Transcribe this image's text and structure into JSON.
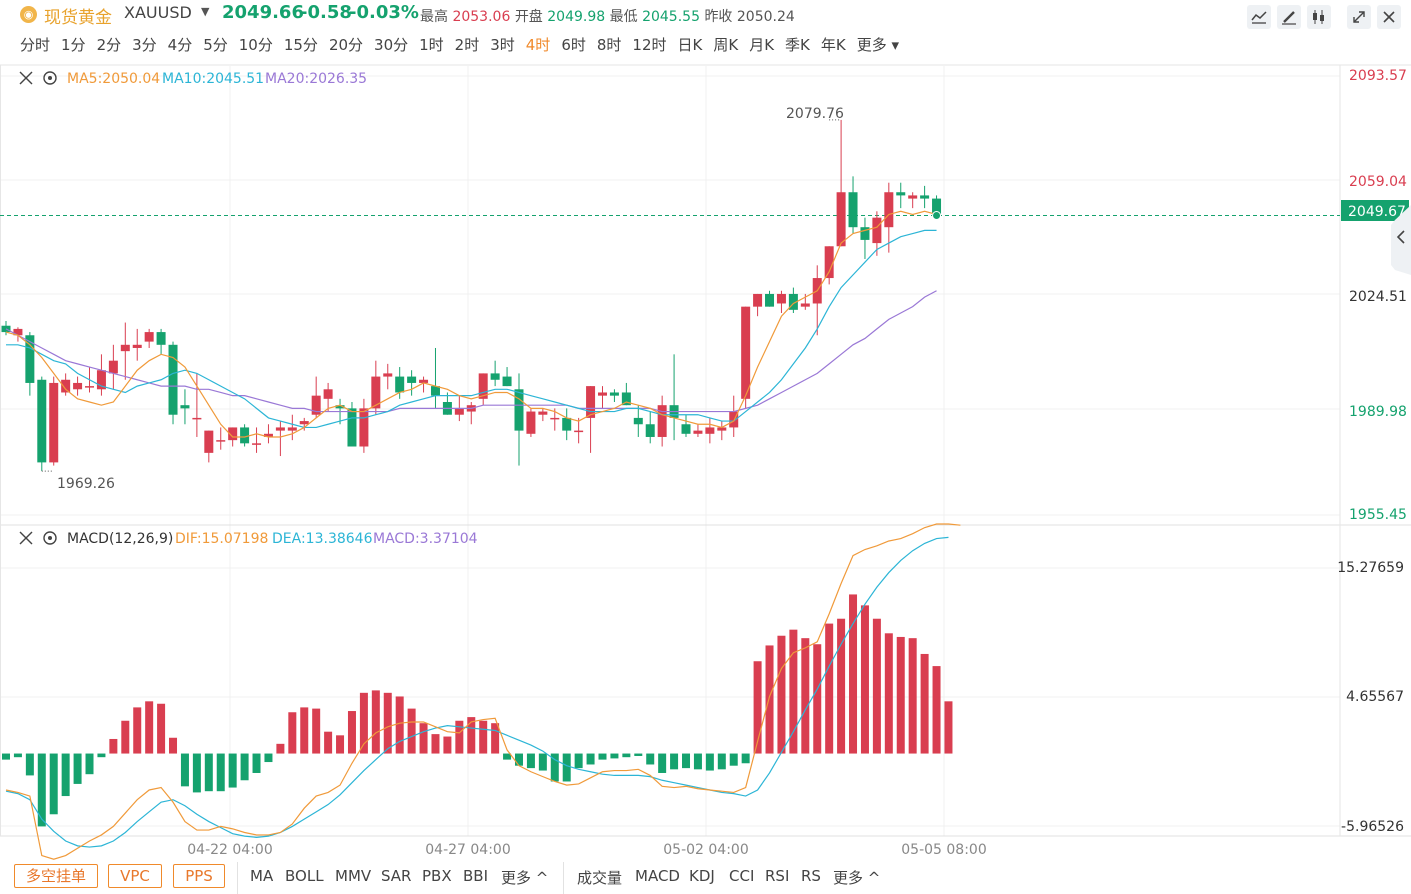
{
  "header": {
    "coin_glyph": "◉",
    "name": "现货黄金",
    "symbol": "XAUUSD",
    "price": "2049.66",
    "change": "-0.58",
    "change_pct": "-0.03%",
    "high_label": "最高",
    "high": "2053.06",
    "open_label": "开盘",
    "open": "2049.98",
    "low_label": "最低",
    "low": "2045.55",
    "prev_label": "昨收",
    "prev": "2050.24",
    "toolbar_icons": [
      "line-tool-icon",
      "draw-pen-icon",
      "candle-style-icon",
      "expand-icon",
      "close-icon"
    ]
  },
  "periods": [
    "分时",
    "1分",
    "2分",
    "3分",
    "4分",
    "5分",
    "10分",
    "15分",
    "20分",
    "30分",
    "1时",
    "2时",
    "3时",
    "4时",
    "6时",
    "8时",
    "12时",
    "日K",
    "周K",
    "月K",
    "季K",
    "年K",
    "更多"
  ],
  "active_period": "4时",
  "main_panel": {
    "ma5": "MA5:2050.04",
    "ma10": "MA10:2045.51",
    "ma20": "MA20:2026.35",
    "y_ticks": [
      "2093.57",
      "2059.04",
      "2024.51",
      "1989.98",
      "1955.45"
    ],
    "current_price": "2049.67",
    "high_marker": "2079.76",
    "low_marker": "1969.26"
  },
  "macd_panel": {
    "title": "MACD(12,26,9)",
    "dif": "DIF:15.07198",
    "dea": "DEA:13.38646",
    "macd": "MACD:3.37104",
    "y_ticks": [
      "15.27659",
      "4.65567",
      "-5.96526"
    ]
  },
  "x_ticks": [
    "04-22 04:00",
    "04-27 04:00",
    "05-02 04:00",
    "05-05 08:00"
  ],
  "bottom_bar": {
    "order_buttons": [
      "多空挂单",
      "VPC",
      "PPS"
    ],
    "main_indicators": [
      "MA",
      "BOLL",
      "MMV",
      "SAR",
      "PBX",
      "BBI",
      "更多 ^"
    ],
    "sub_indicators": [
      "成交量",
      "MACD",
      "KDJ",
      "CCI",
      "RSI",
      "RS",
      "更多 ^"
    ]
  },
  "colors": {
    "up": "#d93e50",
    "down": "#15a26e",
    "ma5": "#f09a3a",
    "ma10": "#2cb5d6",
    "ma20": "#9a78d6",
    "active": "#f08a2b"
  },
  "chart_data": {
    "type": "candlestick",
    "price_range": [
      1955.45,
      2093.57
    ],
    "macd_range": [
      -5.96526,
      15.27659
    ],
    "candles": [
      {
        "o": 2015.0,
        "h": 2016.5,
        "l": 2012.0,
        "c": 2013.0
      },
      {
        "o": 2012.0,
        "h": 2014.5,
        "l": 2010.0,
        "c": 2014.0
      },
      {
        "o": 2012.0,
        "h": 2013.0,
        "l": 1993.0,
        "c": 1997.0
      },
      {
        "o": 1998.0,
        "h": 1999.0,
        "l": 1969.3,
        "c": 1972.0
      },
      {
        "o": 1972.0,
        "h": 1999.0,
        "l": 1971.0,
        "c": 1997.0
      },
      {
        "o": 1994.0,
        "h": 2000.0,
        "l": 1993.0,
        "c": 1998.0
      },
      {
        "o": 1995.0,
        "h": 1999.0,
        "l": 1993.0,
        "c": 1997.0
      },
      {
        "o": 1996.0,
        "h": 2002.0,
        "l": 1994.0,
        "c": 1996.0
      },
      {
        "o": 1995.0,
        "h": 2006.0,
        "l": 1993.0,
        "c": 2001.0
      },
      {
        "o": 2000.0,
        "h": 2009.0,
        "l": 1995.0,
        "c": 2004.0
      },
      {
        "o": 2007.0,
        "h": 2016.0,
        "l": 1998.0,
        "c": 2009.0
      },
      {
        "o": 2008.0,
        "h": 2014.0,
        "l": 2004.0,
        "c": 2009.0
      },
      {
        "o": 2010.0,
        "h": 2014.0,
        "l": 2008.0,
        "c": 2013.0
      },
      {
        "o": 2013.0,
        "h": 2014.0,
        "l": 2006.0,
        "c": 2009.0
      },
      {
        "o": 2009.0,
        "h": 2010.0,
        "l": 1984.0,
        "c": 1987.0
      },
      {
        "o": 1990.0,
        "h": 1995.0,
        "l": 1984.0,
        "c": 1989.0
      },
      {
        "o": 1986.0,
        "h": 2000.0,
        "l": 1980.0,
        "c": 1986.0
      },
      {
        "o": 1975.0,
        "h": 1982.0,
        "l": 1972.0,
        "c": 1982.0
      },
      {
        "o": 1979.0,
        "h": 1983.0,
        "l": 1976.0,
        "c": 1979.0
      },
      {
        "o": 1979.0,
        "h": 1983.0,
        "l": 1977.0,
        "c": 1983.0
      },
      {
        "o": 1983.0,
        "h": 1984.0,
        "l": 1977.0,
        "c": 1978.0
      },
      {
        "o": 1978.0,
        "h": 1983.0,
        "l": 1975.0,
        "c": 1978.0
      },
      {
        "o": 1980.0,
        "h": 1984.0,
        "l": 1978.0,
        "c": 1981.0
      },
      {
        "o": 1982.0,
        "h": 1985.0,
        "l": 1974.0,
        "c": 1983.0
      },
      {
        "o": 1982.0,
        "h": 1987.0,
        "l": 1979.0,
        "c": 1983.0
      },
      {
        "o": 1984.0,
        "h": 1986.0,
        "l": 1982.0,
        "c": 1985.0
      },
      {
        "o": 1987.0,
        "h": 1999.0,
        "l": 1986.0,
        "c": 1993.0
      },
      {
        "o": 1992.0,
        "h": 1997.0,
        "l": 1988.0,
        "c": 1995.0
      },
      {
        "o": 1990.0,
        "h": 1992.0,
        "l": 1984.0,
        "c": 1989.0
      },
      {
        "o": 1989.0,
        "h": 1991.0,
        "l": 1977.0,
        "c": 1977.0
      },
      {
        "o": 1977.0,
        "h": 1992.0,
        "l": 1975.0,
        "c": 1989.0
      },
      {
        "o": 1989.0,
        "h": 2004.0,
        "l": 1987.0,
        "c": 1999.0
      },
      {
        "o": 1999.0,
        "h": 2003.0,
        "l": 1995.0,
        "c": 2000.0
      },
      {
        "o": 1999.0,
        "h": 2002.0,
        "l": 1992.0,
        "c": 1994.0
      },
      {
        "o": 1999.0,
        "h": 2001.0,
        "l": 1993.0,
        "c": 1997.0
      },
      {
        "o": 1997.0,
        "h": 1999.0,
        "l": 1994.0,
        "c": 1998.0
      },
      {
        "o": 1996.0,
        "h": 2008.0,
        "l": 1989.0,
        "c": 1993.0
      },
      {
        "o": 1991.0,
        "h": 1994.0,
        "l": 1987.0,
        "c": 1987.0
      },
      {
        "o": 1987.0,
        "h": 1993.0,
        "l": 1985.0,
        "c": 1989.0
      },
      {
        "o": 1988.0,
        "h": 1991.0,
        "l": 1984.0,
        "c": 1990.0
      },
      {
        "o": 1992.0,
        "h": 2000.0,
        "l": 1990.0,
        "c": 2000.0
      },
      {
        "o": 2000.0,
        "h": 2004.0,
        "l": 1996.0,
        "c": 1998.0
      },
      {
        "o": 1999.0,
        "h": 2002.0,
        "l": 1996.0,
        "c": 1996.0
      },
      {
        "o": 1995.0,
        "h": 2000.0,
        "l": 1971.0,
        "c": 1982.0
      },
      {
        "o": 1981.0,
        "h": 1989.0,
        "l": 1980.0,
        "c": 1988.0
      },
      {
        "o": 1987.0,
        "h": 1989.0,
        "l": 1985.0,
        "c": 1988.0
      },
      {
        "o": 1986.0,
        "h": 1989.0,
        "l": 1982.0,
        "c": 1986.0
      },
      {
        "o": 1986.0,
        "h": 1989.0,
        "l": 1979.0,
        "c": 1982.0
      },
      {
        "o": 1982.0,
        "h": 1986.0,
        "l": 1978.0,
        "c": 1982.0
      },
      {
        "o": 1986.0,
        "h": 1996.0,
        "l": 1975.0,
        "c": 1996.0
      },
      {
        "o": 1993.0,
        "h": 1996.0,
        "l": 1989.0,
        "c": 1994.0
      },
      {
        "o": 1994.0,
        "h": 1995.0,
        "l": 1991.0,
        "c": 1993.0
      },
      {
        "o": 1994.0,
        "h": 1997.0,
        "l": 1990.0,
        "c": 1990.0
      },
      {
        "o": 1986.0,
        "h": 1990.0,
        "l": 1980.0,
        "c": 1984.0
      },
      {
        "o": 1984.0,
        "h": 1988.0,
        "l": 1978.0,
        "c": 1980.0
      },
      {
        "o": 1980.0,
        "h": 1993.0,
        "l": 1977.0,
        "c": 1990.0
      },
      {
        "o": 1990.0,
        "h": 2006.0,
        "l": 1979.0,
        "c": 1986.0
      },
      {
        "o": 1984.0,
        "h": 1987.0,
        "l": 1980.0,
        "c": 1981.0
      },
      {
        "o": 1981.0,
        "h": 1984.0,
        "l": 1980.0,
        "c": 1982.0
      },
      {
        "o": 1981.0,
        "h": 1986.0,
        "l": 1978.0,
        "c": 1983.0
      },
      {
        "o": 1982.0,
        "h": 1985.0,
        "l": 1979.0,
        "c": 1983.0
      },
      {
        "o": 1983.0,
        "h": 1993.0,
        "l": 1980.0,
        "c": 1988.0
      },
      {
        "o": 1992.0,
        "h": 2021.0,
        "l": 1989.0,
        "c": 2021.0
      },
      {
        "o": 2021.0,
        "h": 2025.0,
        "l": 2018.0,
        "c": 2025.0
      },
      {
        "o": 2025.0,
        "h": 2026.0,
        "l": 2021.0,
        "c": 2021.0
      },
      {
        "o": 2022.0,
        "h": 2026.0,
        "l": 2019.0,
        "c": 2025.0
      },
      {
        "o": 2025.0,
        "h": 2027.0,
        "l": 2019.0,
        "c": 2020.0
      },
      {
        "o": 2021.0,
        "h": 2025.0,
        "l": 2020.0,
        "c": 2022.0
      },
      {
        "o": 2022.0,
        "h": 2034.0,
        "l": 2012.0,
        "c": 2030.0
      },
      {
        "o": 2030.0,
        "h": 2040.0,
        "l": 2028.0,
        "c": 2040.0
      },
      {
        "o": 2040.0,
        "h": 2079.76,
        "l": 2040.0,
        "c": 2057.0
      },
      {
        "o": 2057.0,
        "h": 2062.0,
        "l": 2044.0,
        "c": 2046.0
      },
      {
        "o": 2046.0,
        "h": 2049.0,
        "l": 2036.0,
        "c": 2042.0
      },
      {
        "o": 2041.0,
        "h": 2051.0,
        "l": 2037.0,
        "c": 2049.0
      },
      {
        "o": 2046.0,
        "h": 2060.0,
        "l": 2038.0,
        "c": 2057.0
      },
      {
        "o": 2057.0,
        "h": 2060.0,
        "l": 2052.0,
        "c": 2056.0
      },
      {
        "o": 2055.0,
        "h": 2057.0,
        "l": 2052.0,
        "c": 2056.0
      },
      {
        "o": 2056.0,
        "h": 2059.0,
        "l": 2052.0,
        "c": 2055.0
      },
      {
        "o": 2055.0,
        "h": 2056.0,
        "l": 2049.0,
        "c": 2049.67
      }
    ],
    "ma5": [
      2013,
      2012,
      2009,
      2005,
      2000,
      1995,
      1992,
      1991,
      1990,
      1991,
      1996,
      2001,
      2004,
      2006,
      2005,
      2002,
      1996,
      1990,
      1984,
      1980,
      1980,
      1981,
      1980,
      1980,
      1981,
      1983,
      1986,
      1989,
      1990,
      1988,
      1988,
      1990,
      1992,
      1994,
      1995,
      1997,
      1996,
      1995,
      1993,
      1992,
      1993,
      1994,
      1994,
      1992,
      1989,
      1989,
      1988,
      1986,
      1985,
      1987,
      1988,
      1989,
      1991,
      1990,
      1989,
      1987,
      1986,
      1985,
      1984,
      1984,
      1983,
      1985,
      1993,
      2002,
      2010,
      2018,
      2022,
      2024,
      2026,
      2032,
      2041,
      2044,
      2045,
      2046,
      2050,
      2051,
      2050,
      2051,
      2050
    ],
    "ma10": [
      2009,
      2009,
      2008,
      2006,
      2004,
      2003,
      2000,
      1998,
      1996,
      1995,
      1994,
      1996,
      1997,
      1998,
      2000,
      2001,
      2000,
      1998,
      1996,
      1994,
      1992,
      1989,
      1986,
      1985,
      1984,
      1983,
      1983,
      1984,
      1985,
      1986,
      1986,
      1987,
      1988,
      1990,
      1991,
      1992,
      1993,
      1993,
      1993,
      1993,
      1994,
      1995,
      1995,
      1994,
      1993,
      1992,
      1991,
      1990,
      1989,
      1988,
      1988,
      1988,
      1989,
      1989,
      1988,
      1987,
      1987,
      1987,
      1987,
      1986,
      1985,
      1985,
      1988,
      1991,
      1994,
      1998,
      2003,
      2008,
      2014,
      2021,
      2027,
      2031,
      2035,
      2039,
      2041,
      2043,
      2044,
      2045,
      2045
    ],
    "ma20": [
      2014,
      2012,
      2010,
      2008,
      2006,
      2004,
      2003,
      2002,
      2001,
      2000,
      1999,
      1998,
      1997,
      1996,
      1996,
      1996,
      1995,
      1995,
      1994,
      1993,
      1993,
      1992,
      1991,
      1990,
      1989,
      1989,
      1988,
      1988,
      1988,
      1988,
      1988,
      1988,
      1988,
      1989,
      1989,
      1989,
      1989,
      1989,
      1989,
      1989,
      1990,
      1990,
      1990,
      1990,
      1990,
      1990,
      1990,
      1990,
      1989,
      1989,
      1989,
      1989,
      1989,
      1989,
      1989,
      1988,
      1988,
      1988,
      1988,
      1988,
      1988,
      1988,
      1989,
      1990,
      1992,
      1994,
      1996,
      1998,
      2000,
      2003,
      2006,
      2009,
      2011,
      2014,
      2017,
      2019,
      2021,
      2024,
      2026
    ],
    "macd_hist": [
      -0.5,
      -0.3,
      -1.8,
      -6.0,
      -5.0,
      -3.5,
      -2.5,
      -1.7,
      -0.3,
      1.2,
      2.7,
      3.8,
      4.3,
      4.1,
      1.3,
      -2.7,
      -3.2,
      -3.1,
      -3.1,
      -2.8,
      -2.2,
      -1.6,
      -0.7,
      0.8,
      3.4,
      3.8,
      3.7,
      1.8,
      1.5,
      3.5,
      5.0,
      5.2,
      5.0,
      4.7,
      3.7,
      2.5,
      1.6,
      1.4,
      2.7,
      3.0,
      2.7,
      2.5,
      -0.5,
      -1.0,
      -1.2,
      -1.4,
      -2.3,
      -2.3,
      -1.2,
      -0.9,
      -0.5,
      -0.4,
      -0.3,
      -0.2,
      -0.9,
      -1.6,
      -1.3,
      -1.2,
      -1.3,
      -1.4,
      -1.3,
      -1.0,
      -0.8,
      7.6,
      8.9,
      9.7,
      10.2,
      9.5,
      9.0,
      10.7,
      11.1,
      13.1,
      12.2,
      11.1,
      9.9,
      9.6,
      9.5,
      8.2,
      7.2,
      4.3
    ],
    "dif": [
      -3.0,
      -3.2,
      -3.5,
      -8.4,
      -8.7,
      -8.4,
      -7.8,
      -7.2,
      -6.7,
      -6.0,
      -4.9,
      -3.8,
      -3.0,
      -2.8,
      -4.0,
      -5.6,
      -6.3,
      -6.3,
      -6.0,
      -6.2,
      -6.5,
      -6.7,
      -6.7,
      -6.5,
      -5.8,
      -4.5,
      -3.5,
      -3.2,
      -2.6,
      -0.8,
      0.8,
      1.7,
      2.2,
      2.5,
      2.6,
      2.6,
      2.2,
      1.8,
      1.7,
      2.6,
      2.8,
      2.9,
      0.3,
      -1.0,
      -1.5,
      -1.9,
      -2.3,
      -2.6,
      -2.5,
      -2.0,
      -1.5,
      -1.4,
      -1.4,
      -1.3,
      -1.8,
      -2.7,
      -2.8,
      -2.7,
      -2.9,
      -3.0,
      -3.1,
      -3.2,
      -2.8,
      1.0,
      4.7,
      7.0,
      8.3,
      8.7,
      9.2,
      11.5,
      14.0,
      16.3,
      16.8,
      17.1,
      17.5,
      17.7,
      18.1,
      18.6,
      18.9,
      18.9,
      18.8
    ],
    "dea": [
      -3.1,
      -3.3,
      -3.8,
      -5.4,
      -6.4,
      -7.2,
      -7.6,
      -7.7,
      -7.6,
      -7.2,
      -6.5,
      -5.6,
      -4.8,
      -4.0,
      -3.8,
      -4.3,
      -5.0,
      -5.6,
      -6.1,
      -6.6,
      -6.8,
      -6.9,
      -6.8,
      -6.5,
      -6.0,
      -5.4,
      -4.8,
      -4.2,
      -3.4,
      -2.4,
      -1.4,
      -0.5,
      0.4,
      1.0,
      1.4,
      1.8,
      2.1,
      2.3,
      2.2,
      2.1,
      2.0,
      1.9,
      1.5,
      1.1,
      0.7,
      0.2,
      -0.5,
      -1.0,
      -1.3,
      -1.5,
      -1.7,
      -1.8,
      -1.8,
      -1.8,
      -1.9,
      -2.2,
      -2.4,
      -2.6,
      -2.8,
      -3.0,
      -3.2,
      -3.3,
      -3.5,
      -3.0,
      -1.6,
      0.1,
      1.8,
      3.6,
      5.3,
      7.2,
      9.0,
      10.7,
      12.3,
      13.7,
      14.9,
      15.9,
      16.7,
      17.3,
      17.7,
      17.8
    ]
  }
}
